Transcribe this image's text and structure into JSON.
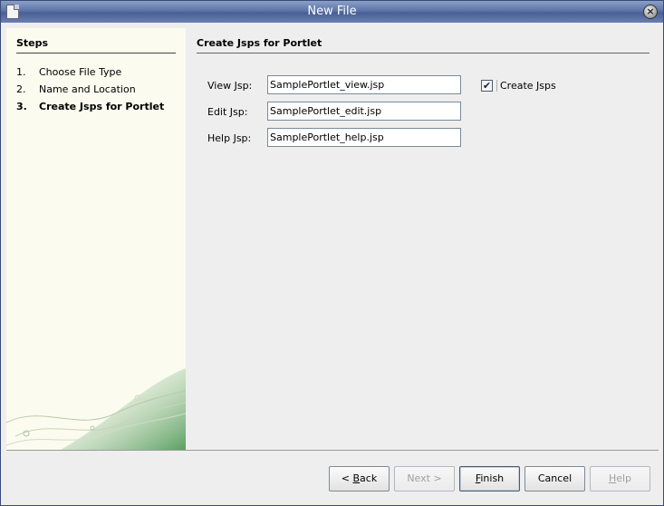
{
  "window": {
    "title": "New File"
  },
  "steps": {
    "title": "Steps",
    "items": [
      {
        "num": "1.",
        "label": "Choose File Type",
        "current": false
      },
      {
        "num": "2.",
        "label": "Name and Location",
        "current": false
      },
      {
        "num": "3.",
        "label": "Create Jsps for Portlet",
        "current": true
      }
    ]
  },
  "main": {
    "title": "Create Jsps for Portlet",
    "fields": [
      {
        "label": "View Jsp:",
        "value": "SamplePortlet_view.jsp"
      },
      {
        "label": "Edit Jsp:",
        "value": "SamplePortlet_edit.jsp"
      },
      {
        "label": "Help Jsp:",
        "value": "SamplePortlet_help.jsp"
      }
    ],
    "create_jsps": {
      "label": "Create Jsps",
      "checked": true
    }
  },
  "buttons": {
    "back": {
      "mnemonic": "B",
      "rest": "ack",
      "prefix": "< ",
      "enabled": true
    },
    "next": {
      "label": "Next >",
      "enabled": false
    },
    "finish": {
      "mnemonic": "F",
      "rest": "inish",
      "enabled": true
    },
    "cancel": {
      "label": "Cancel",
      "enabled": true
    },
    "help": {
      "mnemonic": "H",
      "rest": "elp",
      "enabled": false
    }
  }
}
